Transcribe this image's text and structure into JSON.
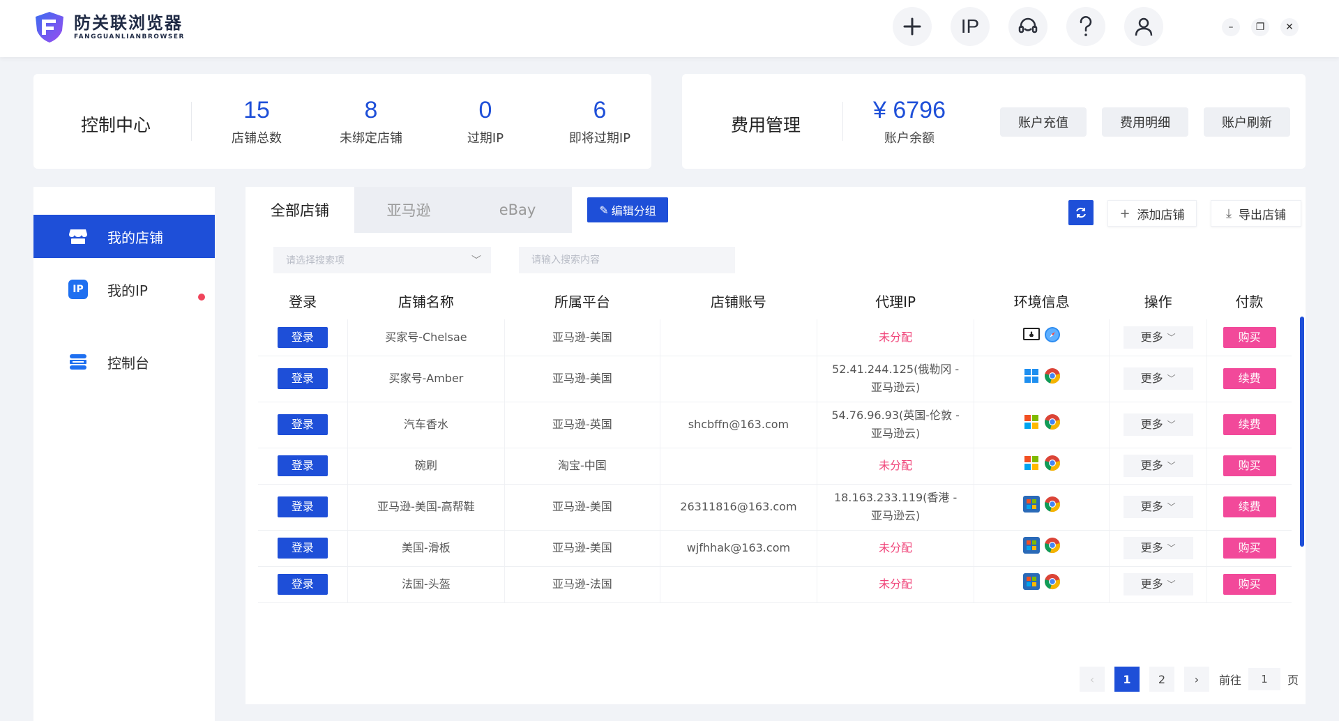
{
  "app": {
    "brand_cn": "防关联浏览器",
    "brand_en": "FANGGUANLIANBROWSER",
    "accent": "#1e4fd8",
    "pink": "#f2499a"
  },
  "top_icons": [
    "plus-icon",
    "IP",
    "support-icon",
    "help-icon",
    "user-icon"
  ],
  "top": {
    "ip_label": "IP"
  },
  "control": {
    "title": "控制中心",
    "stats": [
      {
        "value": "15",
        "label": "店铺总数"
      },
      {
        "value": "8",
        "label": "未绑定店铺"
      },
      {
        "value": "0",
        "label": "过期IP"
      },
      {
        "value": "6",
        "label": "即将过期IP"
      }
    ]
  },
  "cost": {
    "title": "费用管理",
    "balance": "¥ 6796",
    "balance_label": "账户余额",
    "recharge": "账户充值",
    "details": "费用明细",
    "refresh": "账户刷新"
  },
  "sidebar": {
    "items": [
      {
        "label": "我的店铺",
        "icon": "store-icon"
      },
      {
        "label": "我的IP",
        "icon": "ip-icon"
      },
      {
        "label": "控制台",
        "icon": "console-icon"
      }
    ]
  },
  "tabs": [
    "全部店铺",
    "亚马逊",
    "eBay"
  ],
  "toolbar": {
    "edit_group": "编辑分组",
    "add_store": "添加店铺",
    "export_store": "导出店铺"
  },
  "search": {
    "select_placeholder": "请选择搜索项",
    "input_placeholder": "请输入搜索内容"
  },
  "table": {
    "headers": [
      "登录",
      "店铺名称",
      "所属平台",
      "店铺账号",
      "代理IP",
      "环境信息",
      "操作",
      "付款"
    ],
    "login_label": "登录",
    "more_label": "更多",
    "rows": [
      {
        "name": "买家号-Chelsae",
        "platform": "亚马逊-美国",
        "account": "",
        "ip": "未分配",
        "ip2": "",
        "os": "mac",
        "browser": "safari",
        "pay": "购买"
      },
      {
        "name": "买家号-Amber",
        "platform": "亚马逊-美国",
        "account": "",
        "ip": "52.41.244.125(俄勒冈 -",
        "ip2": "亚马逊云)",
        "os": "win10",
        "browser": "chrome",
        "pay": "续费"
      },
      {
        "name": "汽车香水",
        "platform": "亚马逊-英国",
        "account": "shcbffn@163.com",
        "ip": "54.76.96.93(英国-伦敦 -",
        "ip2": "亚马逊云)",
        "os": "winxp",
        "browser": "chrome",
        "pay": "续费"
      },
      {
        "name": "碗刷",
        "platform": "淘宝-中国",
        "account": "",
        "ip": "未分配",
        "ip2": "",
        "os": "winxp",
        "browser": "chrome",
        "pay": "购买"
      },
      {
        "name": "亚马逊-美国-高帮鞋",
        "platform": "亚马逊-美国",
        "account": "26311816@163.com",
        "ip": "18.163.233.119(香港 -",
        "ip2": "亚马逊云)",
        "os": "win7",
        "browser": "chrome",
        "pay": "续费"
      },
      {
        "name": "美国-滑板",
        "platform": "亚马逊-美国",
        "account": "wjfhhak@163.com",
        "ip": "未分配",
        "ip2": "",
        "os": "win7",
        "browser": "chrome",
        "pay": "购买"
      },
      {
        "name": "法国-头盔",
        "platform": "亚马逊-法国",
        "account": "",
        "ip": "未分配",
        "ip2": "",
        "os": "win7",
        "browser": "chrome",
        "pay": "购买"
      }
    ]
  },
  "pagination": {
    "pages": [
      "1",
      "2"
    ],
    "current": "1",
    "goto_label": "前往",
    "goto_value": "1",
    "page_suffix": "页"
  }
}
